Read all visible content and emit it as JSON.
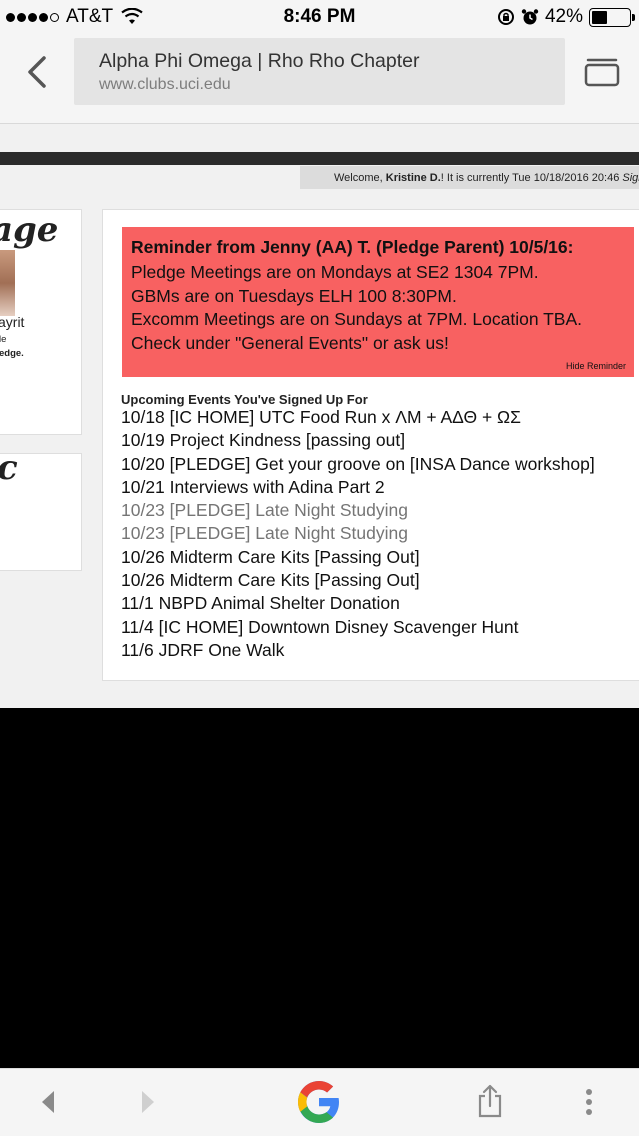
{
  "status_bar": {
    "carrier": "AT&T",
    "time": "8:46 PM",
    "battery": "42%",
    "battery_level": 0.42,
    "signal_bars_filled": 4,
    "signal_bars_total": 5
  },
  "browser": {
    "page_title": "Alpha Phi Omega | Rho Rho Chapter",
    "domain": "www.clubs.uci.edu"
  },
  "welcome": {
    "prefix": "Welcome, ",
    "user": "Kristine D.",
    "middle": "! It is currently Tue 10/18/2016 20:46 ",
    "signout": "Sign"
  },
  "left_panel": {
    "script_title": "age",
    "name_fragment": "ayrit",
    "line1": "le",
    "line2": "edge.",
    "second_card_mark": "c"
  },
  "reminder": {
    "title": "Reminder from Jenny (AA) T. (Pledge Parent) 10/5/16:",
    "lines": [
      "Pledge Meetings are on Mondays at SE2 1304 7PM.",
      "GBMs are on Tuesdays ELH 100 8:30PM.",
      "Excomm Meetings are on Sundays at 7PM. Location TBA.",
      "Check under \"General Events\" or ask us!"
    ],
    "hide_label": "Hide Reminder",
    "bg_color": "#f86161"
  },
  "events": {
    "heading": "Upcoming Events You've Signed Up For",
    "items": [
      "10/18 [IC HOME] UTC Food Run x ΛΜ + ΑΔΘ + ΩΣ",
      "10/19 Project Kindness [passing out]",
      "10/20 [PLEDGE] Get your groove on [INSA Dance workshop]",
      "10/21 Interviews with Adina Part 2",
      "10/23 [PLEDGE] Late Night Studying",
      "10/23 [PLEDGE] Late Night Studying",
      "10/26 Midterm Care Kits [Passing Out]",
      "10/26 Midterm Care Kits [Passing Out]",
      "11/1 NBPD Animal Shelter Donation",
      "11/4 [IC HOME] Downtown Disney Scavenger Hunt",
      "11/6 JDRF One Walk"
    ]
  },
  "toolbar": {
    "icons": [
      "back-arrow-icon",
      "forward-arrow-icon",
      "google-logo",
      "share-icon",
      "more-vert-icon"
    ]
  }
}
